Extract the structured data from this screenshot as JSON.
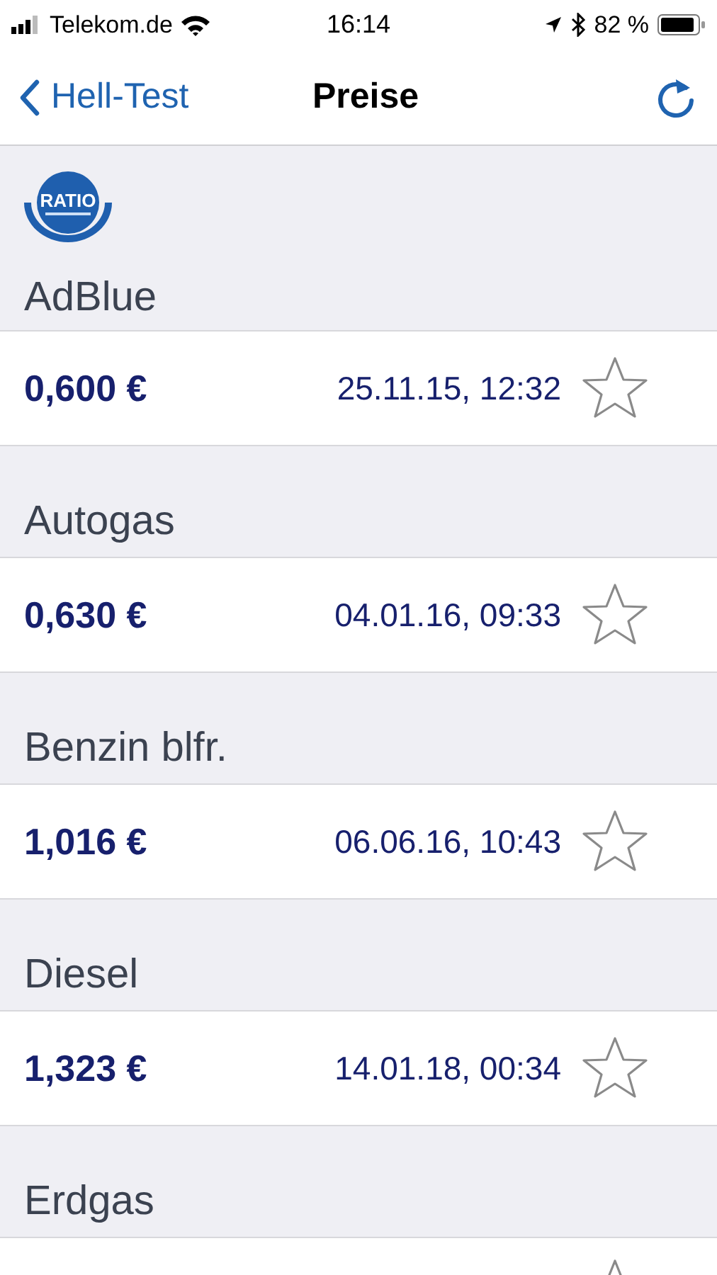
{
  "status_bar": {
    "carrier": "Telekom.de",
    "time": "16:14",
    "battery": "82 %"
  },
  "nav": {
    "back": "Hell-Test",
    "title": "Preise"
  },
  "logo": {
    "text": "RATIO"
  },
  "sections": [
    {
      "title": "AdBlue",
      "price": "0,600 €",
      "date": "25.11.15, 12:32",
      "favorite": false
    },
    {
      "title": "Autogas",
      "price": "0,630 €",
      "date": "04.01.16, 09:33",
      "favorite": false
    },
    {
      "title": "Benzin blfr.",
      "price": "1,016 €",
      "date": "06.06.16, 10:43",
      "favorite": false
    },
    {
      "title": "Diesel",
      "price": "1,323 €",
      "date": "14.01.18, 00:34",
      "favorite": false
    },
    {
      "title": "Erdgas",
      "favorite": false
    }
  ]
}
